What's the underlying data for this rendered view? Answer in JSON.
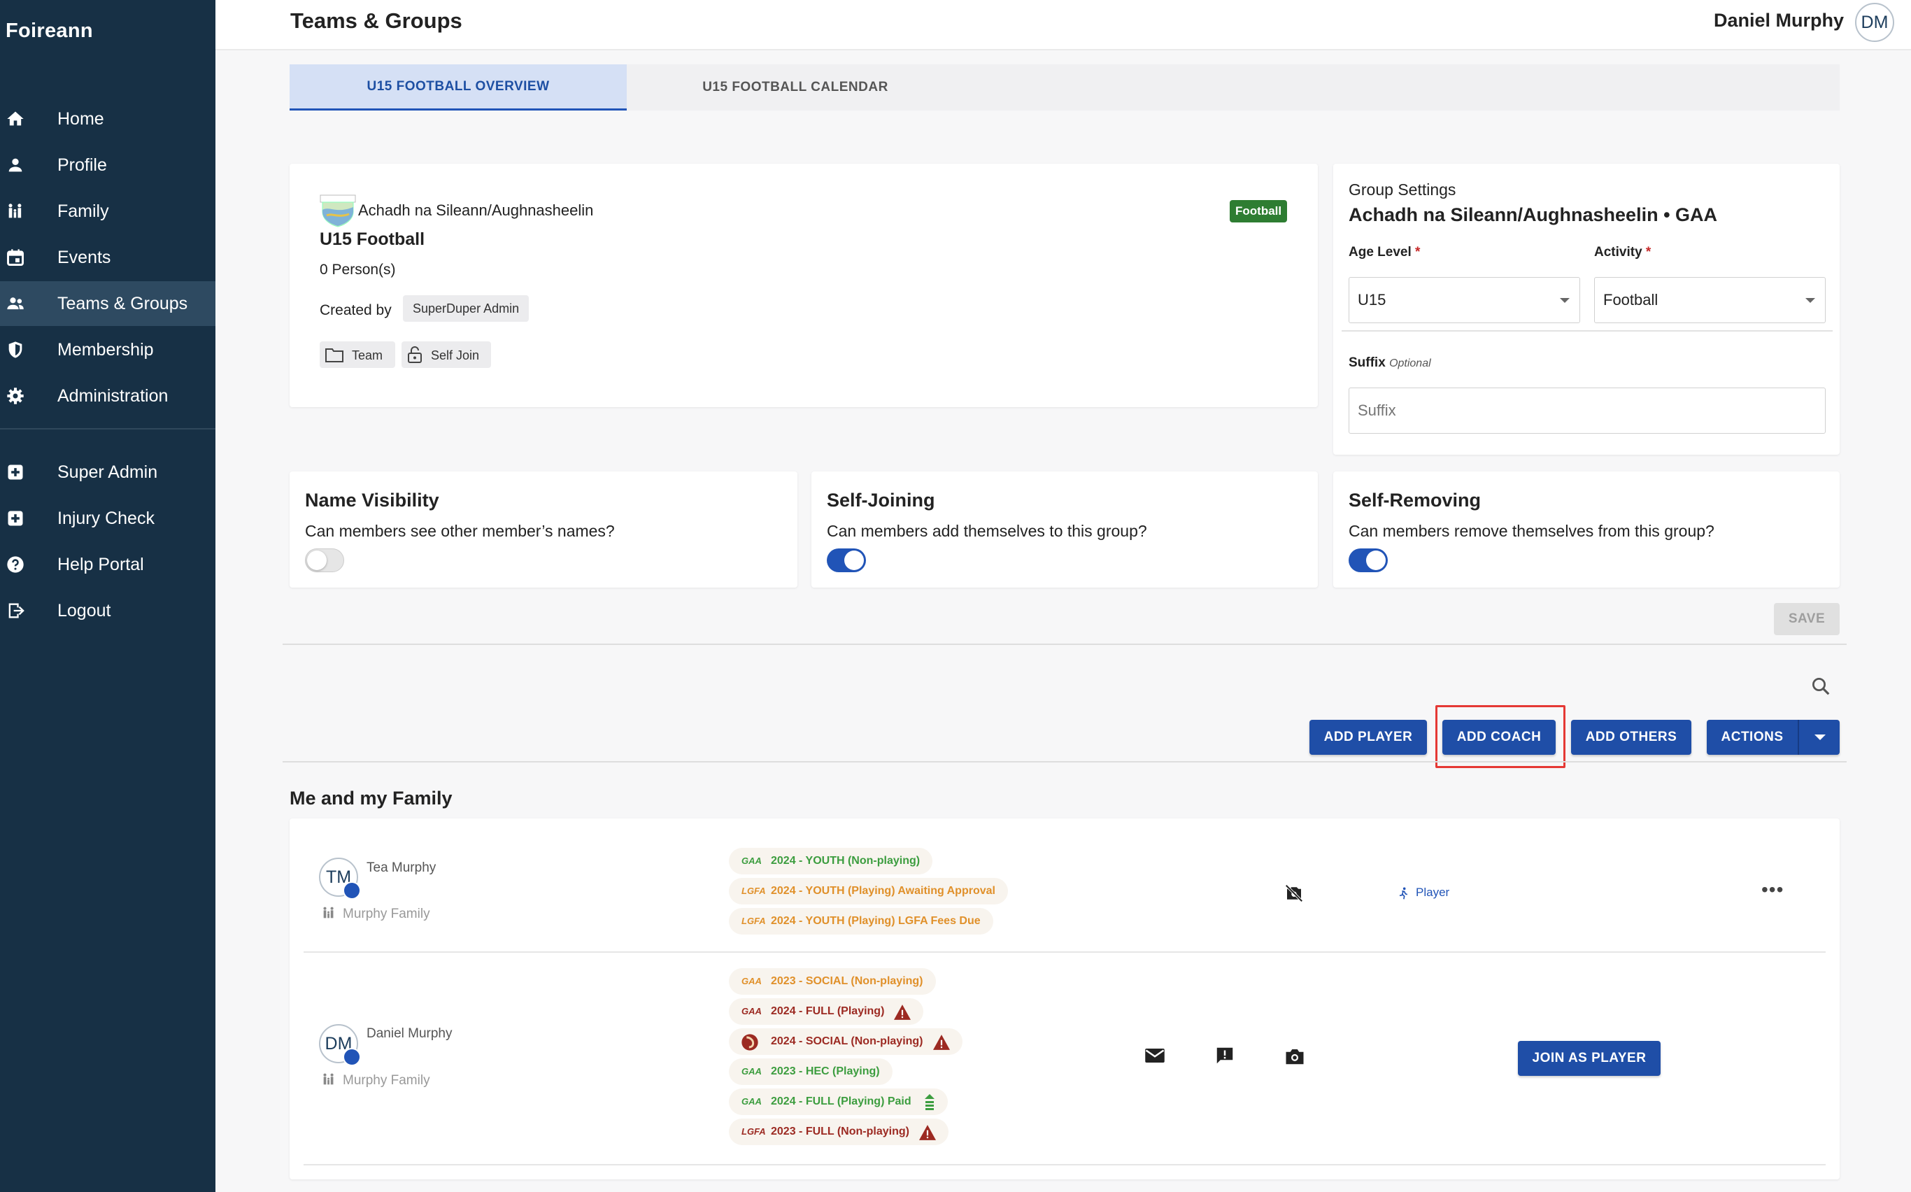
{
  "app": {
    "brand": "Foireann"
  },
  "sidebar": {
    "items": [
      {
        "label": "Home",
        "icon": "home-icon"
      },
      {
        "label": "Profile",
        "icon": "person-icon"
      },
      {
        "label": "Family",
        "icon": "family-icon"
      },
      {
        "label": "Events",
        "icon": "calendar-icon"
      },
      {
        "label": "Teams & Groups",
        "icon": "group-icon",
        "active": true
      },
      {
        "label": "Membership",
        "icon": "shield-icon"
      },
      {
        "label": "Administration",
        "icon": "gear-icon"
      },
      {
        "label": "Super Admin",
        "icon": "plus-box-icon"
      },
      {
        "label": "Injury Check",
        "icon": "plus-box-icon"
      },
      {
        "label": "Help Portal",
        "icon": "help-icon"
      },
      {
        "label": "Logout",
        "icon": "logout-icon"
      }
    ]
  },
  "header": {
    "title": "Teams & Groups",
    "user_name": "Daniel Murphy",
    "user_initials": "DM"
  },
  "tabs": [
    {
      "label": "U15 FOOTBALL OVERVIEW",
      "active": true
    },
    {
      "label": "U15 FOOTBALL CALENDAR",
      "active": false
    }
  ],
  "group_card": {
    "club_name": "Achadh na Sileann/Aughnasheelin",
    "group_name": "U15 Football",
    "person_count": "0 Person(s)",
    "created_by_label": "Created by",
    "created_by": "SuperDuper Admin",
    "activity_badge": "Football",
    "tags": [
      "Team",
      "Self Join"
    ]
  },
  "group_settings": {
    "heading": "Group Settings",
    "club_title": "Achadh na Sileann/Aughnasheelin • GAA",
    "age_level_label": "Age Level",
    "age_level_value": "U15",
    "activity_label": "Activity",
    "activity_value": "Football",
    "required_mark": "*",
    "suffix_label": "Suffix",
    "suffix_optional": "Optional",
    "suffix_placeholder": "Suffix"
  },
  "toggles": [
    {
      "title": "Name Visibility",
      "question": "Can members see other member’s names?",
      "on": false
    },
    {
      "title": "Self-Joining",
      "question": "Can members add themselves to this group?",
      "on": true
    },
    {
      "title": "Self-Removing",
      "question": "Can members remove themselves from this group?",
      "on": true
    }
  ],
  "actions": {
    "save": "SAVE",
    "add_player": "ADD PLAYER",
    "add_coach": "ADD COACH",
    "add_others": "ADD OTHERS",
    "actions": "ACTIONS"
  },
  "family_section": {
    "title": "Me and my Family",
    "members": [
      {
        "name": "Tea Murphy",
        "initials": "TM",
        "family": "Murphy Family",
        "memberships": [
          {
            "logo": "GAA",
            "text": "2024 - YOUTH (Non-playing)",
            "color": "green"
          },
          {
            "logo": "LGFA",
            "text": "2024 - YOUTH (Playing) Awaiting Approval",
            "color": "orange"
          },
          {
            "logo": "LGFA",
            "text": "2024 - YOUTH (Playing) LGFA Fees Due",
            "color": "orange"
          }
        ],
        "role": "Player"
      },
      {
        "name": "Daniel Murphy",
        "initials": "DM",
        "family": "Murphy Family",
        "memberships": [
          {
            "logo": "GAA",
            "text": "2023 - SOCIAL (Non-playing)",
            "color": "orange"
          },
          {
            "logo": "GAA",
            "text": "2024 - FULL (Playing)",
            "color": "red",
            "warning": true
          },
          {
            "logo": "crest",
            "text": "2024 - SOCIAL (Non-playing)",
            "color": "red",
            "warning": true
          },
          {
            "logo": "GAA",
            "text": "2023 - HEC (Playing)",
            "color": "green"
          },
          {
            "logo": "GAA",
            "text": "2024 - FULL (Playing) Paid",
            "color": "green",
            "paid": true
          },
          {
            "logo": "LGFA",
            "text": "2023 - FULL (Non-playing)",
            "color": "red",
            "warning": true
          }
        ],
        "join_button": "JOIN AS PLAYER"
      }
    ]
  },
  "colors": {
    "sidebar_bg": "#173045",
    "primary": "#1f4ea7",
    "highlight_border": "#e53935"
  }
}
